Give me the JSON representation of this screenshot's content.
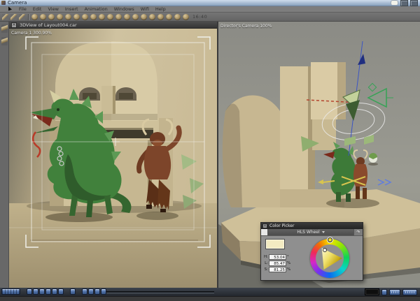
{
  "window": {
    "title": "Camera"
  },
  "menubar": {
    "items": [
      {
        "label": "File",
        "name": "menu-file"
      },
      {
        "label": "Edit",
        "name": "menu-edit"
      },
      {
        "label": "View",
        "name": "menu-view"
      },
      {
        "label": "Insert",
        "name": "menu-insert"
      },
      {
        "label": "Animation",
        "name": "menu-animation"
      },
      {
        "label": "Windows",
        "name": "menu-windows"
      },
      {
        "label": "Wifi",
        "name": "menu-wifi"
      },
      {
        "label": "Help",
        "name": "menu-help"
      }
    ]
  },
  "toolbar": {
    "clock": "16:40",
    "left_icons": [
      {
        "name": "pen-tool-icon"
      },
      {
        "name": "knife-tool-icon"
      },
      {
        "name": "brush-tool-icon"
      }
    ],
    "icons": [
      {
        "name": "toolbar-icon-1"
      },
      {
        "name": "toolbar-icon-2"
      },
      {
        "name": "toolbar-icon-3"
      },
      {
        "name": "toolbar-icon-4"
      },
      {
        "name": "toolbar-icon-5"
      },
      {
        "name": "toolbar-icon-6"
      },
      {
        "name": "toolbar-icon-7"
      },
      {
        "name": "toolbar-icon-8"
      },
      {
        "name": "toolbar-icon-9"
      },
      {
        "name": "toolbar-icon-10"
      },
      {
        "name": "toolbar-icon-11"
      },
      {
        "name": "toolbar-icon-12"
      },
      {
        "name": "toolbar-icon-13"
      },
      {
        "name": "toolbar-icon-14"
      },
      {
        "name": "toolbar-icon-15"
      },
      {
        "name": "toolbar-icon-16"
      },
      {
        "name": "toolbar-icon-17"
      },
      {
        "name": "toolbar-icon-18"
      },
      {
        "name": "toolbar-icon-19"
      }
    ]
  },
  "left_strip": {
    "icons": [
      {
        "name": "side-tool-icon-1"
      },
      {
        "name": "side-tool-icon-2"
      }
    ]
  },
  "left_view": {
    "title": "3DView of Layout004.car",
    "camera_label": "Camera 1 300.90%"
  },
  "right_view": {
    "camera_label": "Director's Camera 100%"
  },
  "color_picker": {
    "title": "Color Picker",
    "mode_label": "HLS Wheel",
    "swatch_color": "#f3ebc2",
    "fields": [
      {
        "label": "H:",
        "value": "53.04",
        "unit": "°"
      },
      {
        "label": "L:",
        "value": "85.47",
        "unit": "%"
      },
      {
        "label": "S:",
        "value": "81.25",
        "unit": "%"
      }
    ]
  },
  "transport": {
    "main": [
      {
        "name": "rewind-button"
      },
      {
        "name": "step-back-button"
      },
      {
        "name": "stop-button"
      },
      {
        "name": "play-button"
      },
      {
        "name": "step-forward-button"
      },
      {
        "name": "fast-forward-button"
      }
    ],
    "extra": [
      {
        "name": "loop-button"
      }
    ],
    "nav": [
      {
        "name": "first-frame-button"
      },
      {
        "name": "prev-key-button"
      },
      {
        "name": "next-key-button"
      },
      {
        "name": "last-frame-button"
      }
    ]
  },
  "colors": {
    "titlebar_blue": "#9db3cc",
    "button_blue": "#4c6da3",
    "scene_tan": "#cfc2a0",
    "dragon_green": "#41813c",
    "creature_brown": "#7d452a"
  }
}
